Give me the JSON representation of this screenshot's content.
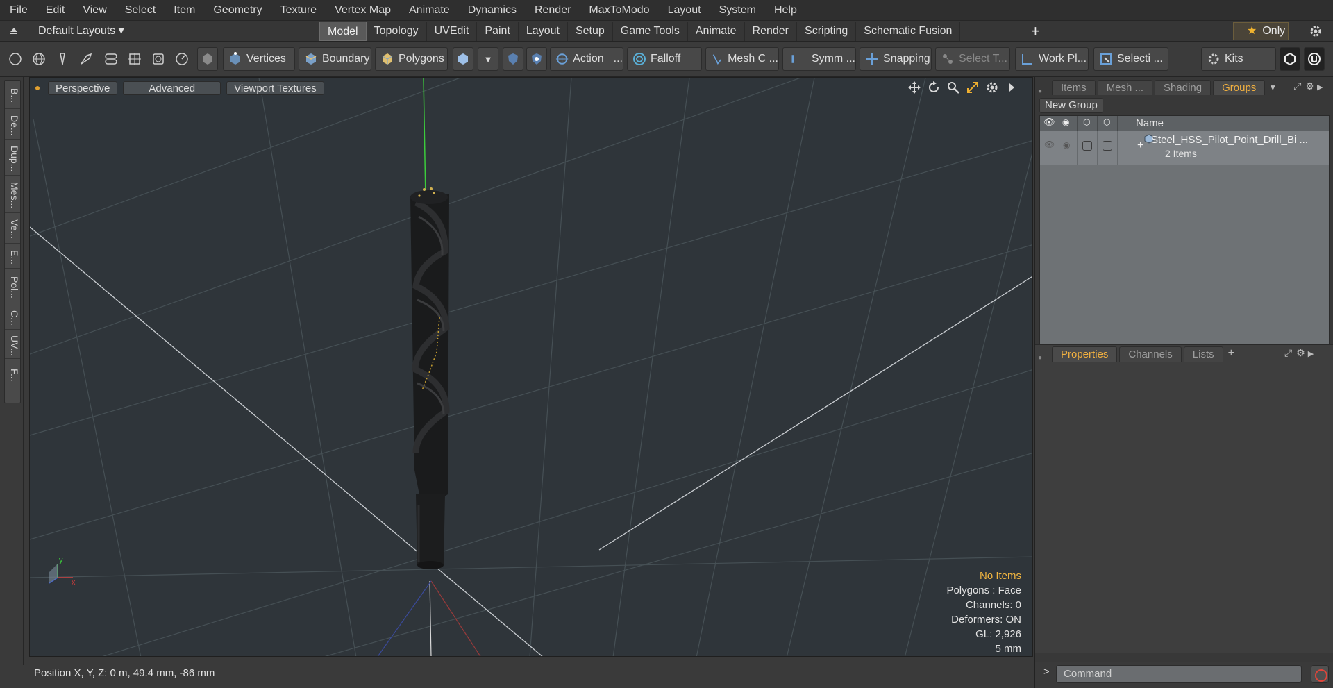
{
  "menu": [
    "File",
    "Edit",
    "View",
    "Select",
    "Item",
    "Geometry",
    "Texture",
    "Vertex Map",
    "Animate",
    "Dynamics",
    "Render",
    "MaxToModo",
    "Layout",
    "System",
    "Help"
  ],
  "layout_bar": {
    "layouts_label": "Default Layouts",
    "tabs": [
      "Model",
      "Topology",
      "UVEdit",
      "Paint",
      "Layout",
      "Setup",
      "Game Tools",
      "Animate",
      "Render",
      "Scripting",
      "Schematic Fusion"
    ],
    "active_tab": "Model",
    "only_label": "Only"
  },
  "toolbar": {
    "vertices": "Vertices",
    "boundary": "Boundary",
    "polygons": "Polygons",
    "action": "Action",
    "action_more": "...",
    "falloff": "Falloff",
    "mesh": "Mesh C ...",
    "symmetry": "Symm ...",
    "snapping": "Snapping",
    "select_t": "Select T...",
    "workplane": "Work Pl...",
    "selection": "Selecti ...",
    "kits": "Kits"
  },
  "left_tabs": [
    "B...",
    "De...",
    "Dup...",
    "Mes...",
    "Ve...",
    "E...",
    "Pol...",
    "C...",
    "UV...",
    "F..."
  ],
  "viewport": {
    "header": [
      "Perspective",
      "Advanced",
      "Viewport Textures"
    ],
    "stats": {
      "selection": "No Items",
      "polygons": "Polygons : Face",
      "channels": "Channels: 0",
      "deformers": "Deformers: ON",
      "gl": "GL: 2,926",
      "unit": "5 mm"
    }
  },
  "status": {
    "position": "Position X, Y, Z:   0 m, 49.4 mm, -86 mm"
  },
  "right_panel": {
    "top_tabs": [
      "Items",
      "Mesh ...",
      "Shading",
      "Groups"
    ],
    "top_active": "Groups",
    "new_group": "New Group",
    "name_header": "Name",
    "group_row": {
      "name": "Steel_HSS_Pilot_Point_Drill_Bi ...",
      "count": "2 Items"
    },
    "bottom_tabs": [
      "Properties",
      "Channels",
      "Lists"
    ],
    "bottom_active": "Properties",
    "command_placeholder": "Command"
  },
  "colors": {
    "accent": "#f1b040",
    "viewport_bg": "#2f353a",
    "axis_y": "#3ccc3c",
    "axis_x": "#cc3c3c",
    "axis_z": "#3c5ccc"
  }
}
